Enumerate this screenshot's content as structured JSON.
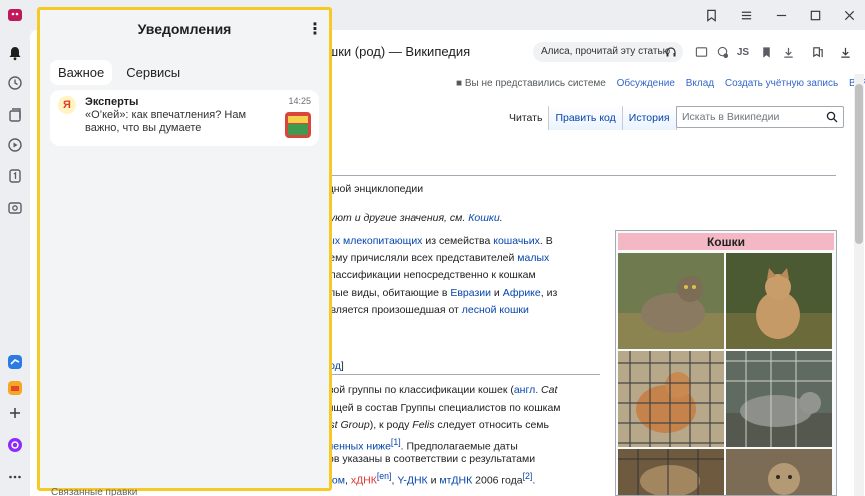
{
  "browser": {
    "tab_title": "Кошки (род) — Википедия",
    "alice_prompt": "Алиса, прочитай эту статью",
    "js_label": "JS"
  },
  "wiki": {
    "personal": {
      "anon": "Вы не представились системе",
      "talk": "Обсуждение",
      "contrib": "Вклад",
      "create": "Создать учётную запись",
      "login": "Войти"
    },
    "tabs": [
      "Читать",
      "Править код",
      "История"
    ],
    "search_placeholder": "Искать в Википедии",
    "subtitle": "бодной энциклопедии",
    "hatnote": "твуют и другие значения, см. ",
    "hatnote_link": "Кошки",
    "p1": {
      "a": "чных млекопитающих",
      "b": " из семейства ",
      "c": "кошачьих",
      "d": ". В",
      "e": "к нему причисляли всех представителей ",
      "f": "малых",
      "g": "й классификации непосредственно к кошкам",
      "h": "малые виды, обитающие в ",
      "i": "Евразии",
      "j": " и ",
      "k": "Африке",
      "l": ", из",
      "m": "й является произошедшая от ",
      "n": "лесной кошки"
    },
    "edit_link": "ь код",
    "p2": {
      "a": "левой группы по классификации кошек (",
      "b": "англ.",
      "c": " Cat",
      "d": "одящей в состав Группы специалистов по кошкам",
      "e": "/alist Group",
      "f": "), к роду ",
      "g": "Felis",
      "h": " следует относить семь",
      "i": "исленных ниже",
      "j": "[1]",
      "k": ". Предполагаемые даты",
      "l": "идов указаны в соответствии с результатами",
      "m": "тосом",
      "n": ", ",
      "o": "хДНК",
      "p": "[en]",
      "q": ", ",
      "r": "Y-ДНК",
      "s": " и ",
      "t": "мтДНК",
      "u": " 2006 года",
      "v": "[2]",
      "w": "."
    },
    "infobox_title": "Кошки"
  },
  "panel": {
    "title": "Уведомления",
    "tabs": [
      "Важное",
      "Сервисы"
    ],
    "notification": {
      "sender": "Эксперты",
      "time": "14:25",
      "text": "«О’кей»: как впечатления? Нам важно, что вы думаете",
      "logo_text": "Я"
    }
  },
  "bottom_crumb": "Связанные правки",
  "colors": {
    "panel_border": "#f6c924",
    "link": "#0645ad",
    "infobox_header": "#f4b8c4"
  },
  "icons": [
    "bell-icon",
    "clock-icon",
    "collections-icon",
    "play-icon",
    "counter-icon",
    "screenshot-icon",
    "todo-app-icon",
    "mail-app-icon",
    "plus-icon",
    "alice-icon",
    "more-icon"
  ]
}
